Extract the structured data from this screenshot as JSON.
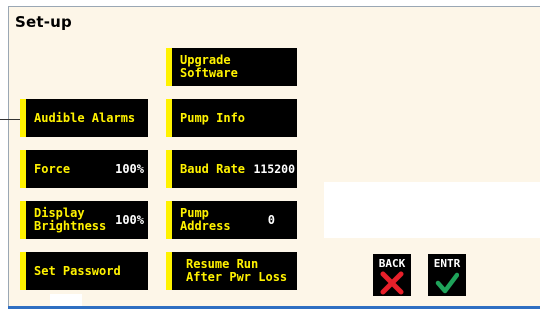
{
  "title": "Set-up",
  "buttons_left": [
    {
      "label": "Audible Alarms",
      "value": ""
    },
    {
      "label": "Force",
      "value": "100%"
    },
    {
      "label": "Display\nBrightness",
      "value": "100%"
    },
    {
      "label": "Set Password",
      "value": ""
    }
  ],
  "buttons_right": [
    {
      "label": "Upgrade\nSoftware",
      "value": ""
    },
    {
      "label": "Pump Info",
      "value": ""
    },
    {
      "label": "Baud Rate",
      "value": "115200"
    },
    {
      "label": "Pump\nAddress",
      "value": "0"
    },
    {
      "label": "Resume Run\nAfter Pwr Loss",
      "value": ""
    }
  ],
  "back_label": "BACK",
  "enter_label": "ENTR",
  "colors": {
    "accent": "#fff200",
    "background": "#fdf6e8",
    "back_icon": "#e8202a",
    "enter_icon": "#1fa35a"
  }
}
